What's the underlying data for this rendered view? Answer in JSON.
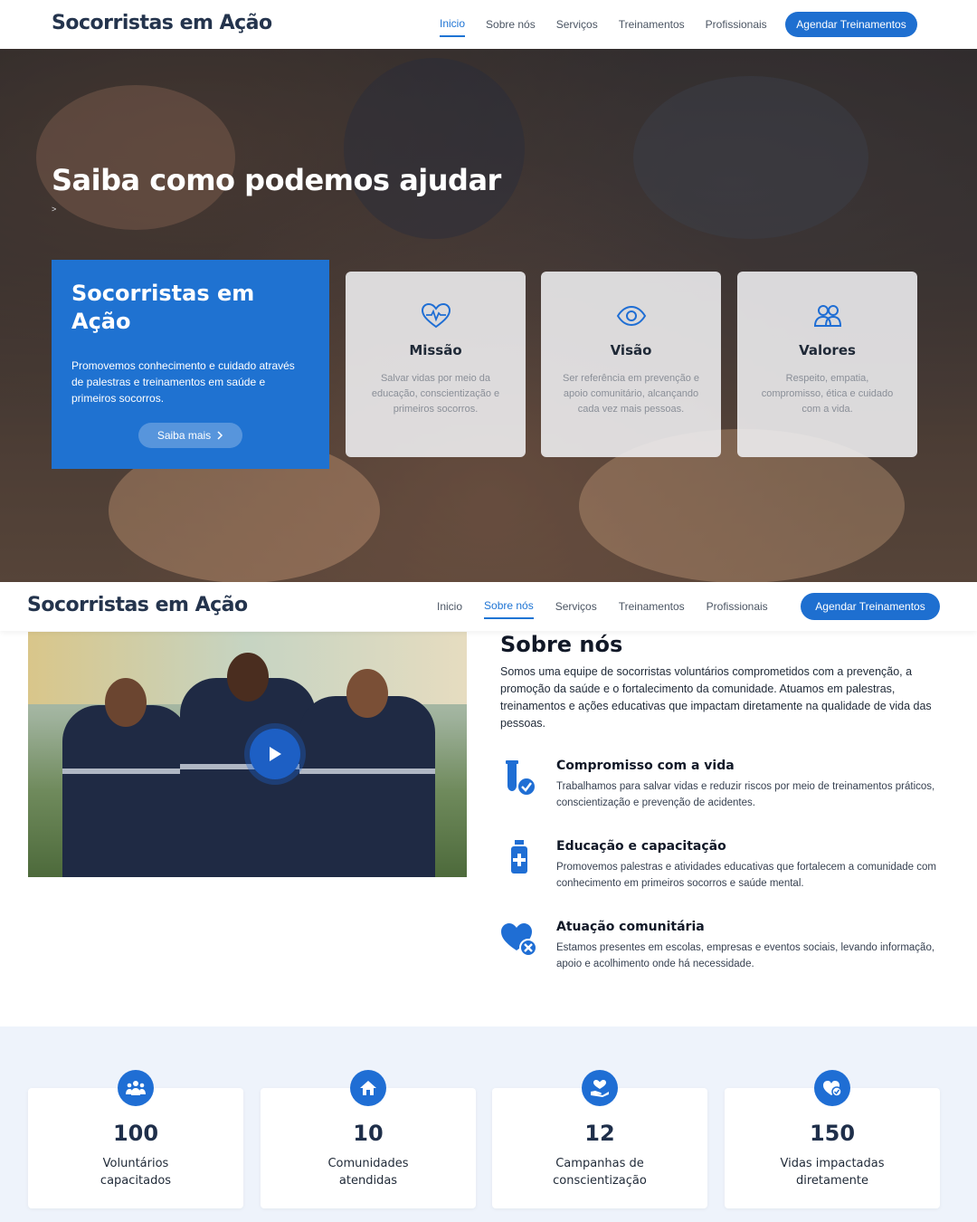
{
  "brand": "Socorristas em Ação",
  "nav": {
    "items": [
      "Inicio",
      "Sobre nós",
      "Serviços",
      "Treinamentos",
      "Profissionais"
    ],
    "cta": "Agendar Treinamentos"
  },
  "hero": {
    "title": "Saiba como podemos ajudar",
    "breadcrumb": ">",
    "intro": {
      "title": "Socorristas em Ação",
      "text": "Promovemos conhecimento e cuidado através de palestras e treinamentos em saúde e primeiros socorros.",
      "button": "Saiba mais"
    },
    "cards": [
      {
        "icon": "heart-pulse-icon",
        "title": "Missão",
        "text": "Salvar vidas por meio da educação, conscientização e primeiros socorros."
      },
      {
        "icon": "eye-icon",
        "title": "Visão",
        "text": "Ser referência em prevenção e apoio comunitário, alcançando cada vez mais pessoas."
      },
      {
        "icon": "users-icon",
        "title": "Valores",
        "text": "Respeito, empatia, compromisso, ética e cuidado com a vida."
      }
    ]
  },
  "about": {
    "title": "Sobre nós",
    "text": "Somos uma equipe de socorristas voluntários comprometidos com a prevenção, a promoção da saúde e o fortalecimento da comunidade. Atuamos em palestras, treinamentos e ações educativas que impactam diretamente na qualidade de vida das pessoas.",
    "features": [
      {
        "icon": "test-tube-check-icon",
        "title": "Compromisso com a vida",
        "text": "Trabalhamos para salvar vidas e reduzir riscos por meio de treinamentos práticos, conscientização e prevenção de acidentes."
      },
      {
        "icon": "medicine-bottle-icon",
        "title": "Educação e capacitação",
        "text": "Promovemos palestras e atividades educativas que fortalecem a comunidade com conhecimento em primeiros socorros e saúde mental."
      },
      {
        "icon": "heart-x-icon",
        "title": "Atuação comunitária",
        "text": "Estamos presentes em escolas, empresas e eventos sociais, levando informação, apoio e acolhimento onde há necessidade."
      }
    ]
  },
  "stats": [
    {
      "icon": "people-group-icon",
      "value": "100",
      "label": "Voluntários capacitados"
    },
    {
      "icon": "house-icon",
      "value": "10",
      "label": "Comunidades atendidas"
    },
    {
      "icon": "hand-heart-icon",
      "value": "12",
      "label": "Campanhas de conscientização"
    },
    {
      "icon": "heart-badge-icon",
      "value": "150",
      "label": "Vidas impactadas diretamente"
    }
  ],
  "colors": {
    "primary": "#1f72d1",
    "brand_text": "#24344d",
    "stats_bg": "#eef3fb"
  }
}
